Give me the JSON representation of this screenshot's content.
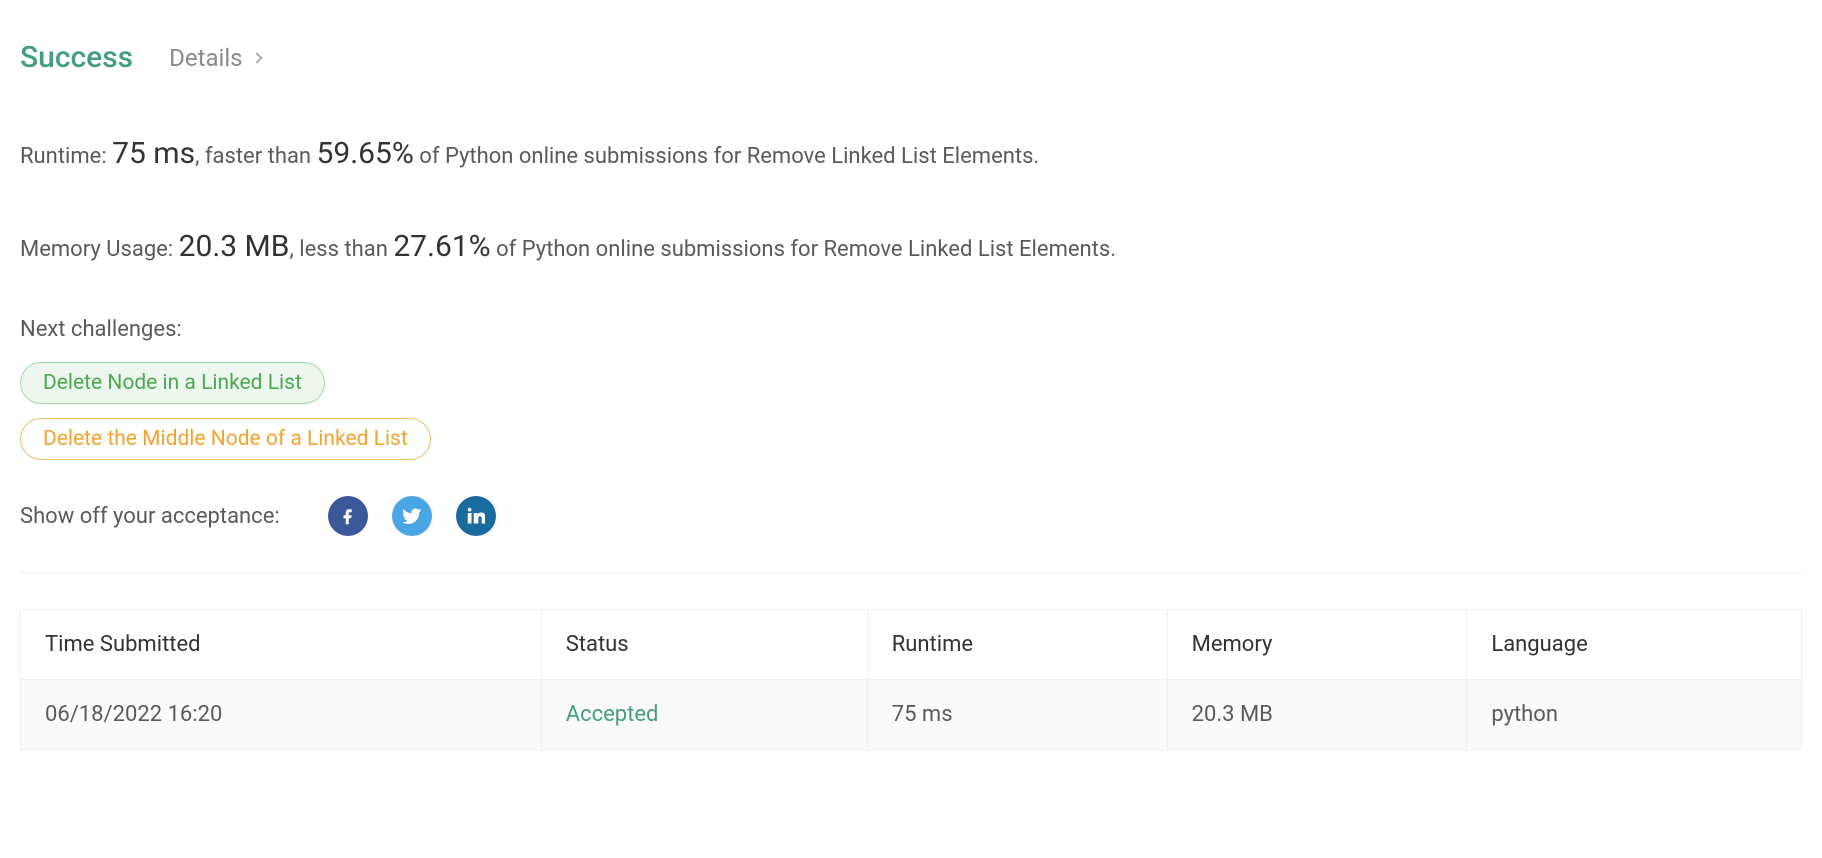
{
  "header": {
    "status": "Success",
    "details": "Details"
  },
  "runtime": {
    "label": "Runtime: ",
    "value": "75 ms",
    "sep1": ", faster than ",
    "percent": "59.65%",
    "tail": " of Python online submissions for Remove Linked List Elements."
  },
  "memory": {
    "label": "Memory Usage: ",
    "value": "20.3 MB",
    "sep1": ", less than ",
    "percent": "27.61%",
    "tail": " of Python online submissions for Remove Linked List Elements."
  },
  "next_challenges_label": "Next challenges:",
  "challenges": {
    "c0": "Delete Node in a Linked List",
    "c1": "Delete the Middle Node of a Linked List"
  },
  "share_label": "Show off your acceptance:",
  "table": {
    "headers": {
      "time": "Time Submitted",
      "status": "Status",
      "runtime": "Runtime",
      "memory": "Memory",
      "language": "Language"
    },
    "row": {
      "time": "06/18/2022 16:20",
      "status": "Accepted",
      "runtime": "75 ms",
      "memory": "20.3 MB",
      "language": "python"
    }
  }
}
